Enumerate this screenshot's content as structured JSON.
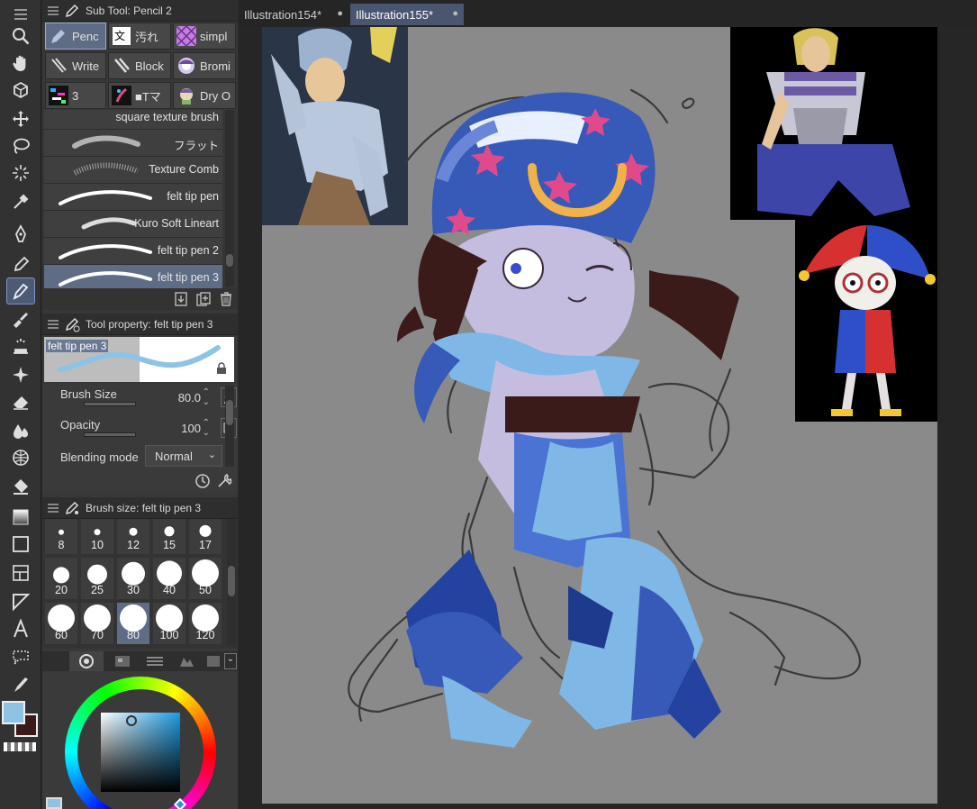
{
  "sub_tool_panel": {
    "title": "Sub Tool: Pencil 2",
    "groups": [
      {
        "label": "Penc",
        "icon": "pencil-icon"
      },
      {
        "label": "汚れ",
        "icon": "stamp-icon"
      },
      {
        "label": "simpl",
        "icon": "pattern-icon"
      },
      {
        "label": "Write",
        "icon": "write-pen-icon"
      },
      {
        "label": "Block",
        "icon": "block-icon"
      },
      {
        "label": "Bromi",
        "icon": "character-icon"
      },
      {
        "label": "3",
        "icon": "glitch-icon"
      },
      {
        "label": "■Tマ",
        "icon": "ink-icon"
      },
      {
        "label": "Dry O",
        "icon": "character-icon"
      }
    ],
    "brushes": [
      {
        "name": "square texture brush"
      },
      {
        "name": "フラット"
      },
      {
        "name": "Texture Comb"
      },
      {
        "name": "felt tip pen"
      },
      {
        "name": "Kuro Soft Lineart"
      },
      {
        "name": "felt tip pen 2"
      },
      {
        "name": "felt tip pen 3"
      }
    ]
  },
  "tool_property_panel": {
    "title": "Tool property: felt tip pen 3",
    "preview_label": "felt tip pen 3",
    "brush_size": {
      "label": "Brush Size",
      "value": "80.0"
    },
    "opacity": {
      "label": "Opacity",
      "value": "100"
    },
    "blending_mode": {
      "label": "Blending mode",
      "value": "Normal"
    }
  },
  "brush_size_panel": {
    "title": "Brush size: felt tip pen 3",
    "sizes": [
      "8",
      "10",
      "12",
      "15",
      "17",
      "20",
      "25",
      "30",
      "40",
      "50",
      "60",
      "70",
      "80",
      "100",
      "120"
    ],
    "selected": "80"
  },
  "document_tabs": [
    {
      "label": "Illustration154*"
    },
    {
      "label": "Illustration155*"
    }
  ],
  "colors": {
    "main_color": "#8fc3e6",
    "sub_color": "#3b1a1a",
    "accent": "#5f6c86",
    "canvas_bg": "#8a8a8a"
  }
}
